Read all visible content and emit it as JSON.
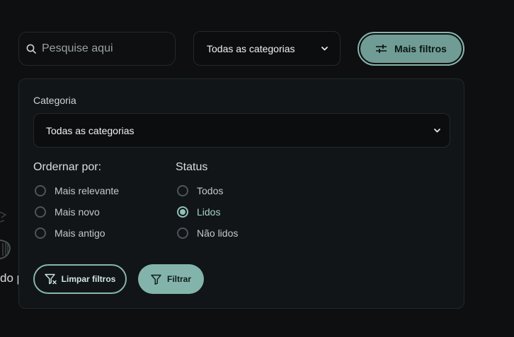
{
  "search": {
    "placeholder": "Pesquise aqui",
    "icon": "search-icon"
  },
  "category_select_top": {
    "value": "Todas as categorias",
    "icon": "chevron-down-icon"
  },
  "more_filters_button": {
    "label": "Mais filtros",
    "icon": "sliders-icon"
  },
  "filter_panel": {
    "category_label": "Categoria",
    "category_value": "Todas as categorias",
    "order_by": {
      "title": "Ordernar por:",
      "options": [
        {
          "label": "Mais relevante",
          "checked": false
        },
        {
          "label": "Mais novo",
          "checked": false
        },
        {
          "label": "Mais antigo",
          "checked": false
        }
      ]
    },
    "status": {
      "title": "Status",
      "options": [
        {
          "label": "Todos",
          "checked": false
        },
        {
          "label": "Lidos",
          "checked": true
        },
        {
          "label": "Não lidos",
          "checked": false
        }
      ]
    },
    "clear_button": {
      "label": "Limpar filtros",
      "icon": "filter-clear-icon"
    },
    "filter_button": {
      "label": "Filtrar",
      "icon": "filter-icon"
    }
  },
  "background": {
    "partial_text": "do p"
  },
  "colors": {
    "background": "#0d0f10",
    "panel": "#111517",
    "accent": "#82b4ab",
    "accent_dark": "#6f9d95"
  }
}
